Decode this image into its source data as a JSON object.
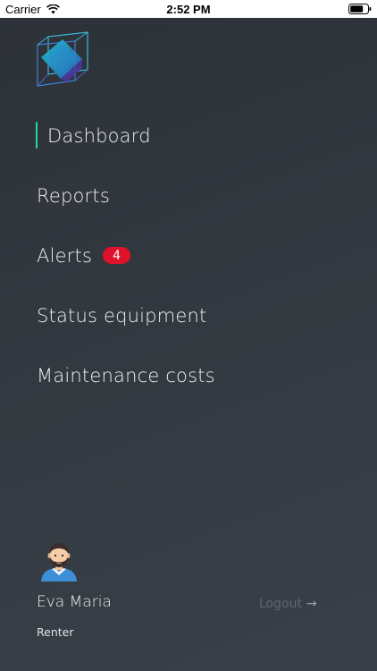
{
  "status_bar": {
    "carrier": "Carrier",
    "time": "2:52 PM",
    "wifi_icon": "wifi-icon",
    "battery_icon": "battery-icon"
  },
  "drawer": {
    "logo_icon": "cube-logo-icon",
    "colors": {
      "background": "#30363c",
      "active_indicator": "#23d6a0",
      "badge": "#e0112b",
      "logout_text": "#5e666f"
    },
    "menu": {
      "items": [
        {
          "label": "Dashboard",
          "active": true
        },
        {
          "label": "Reports"
        },
        {
          "label": "Alerts",
          "badge": "4"
        },
        {
          "label": "Status equipment"
        },
        {
          "label": "Maintenance costs"
        }
      ]
    },
    "user": {
      "avatar_icon": "bearded-man-avatar",
      "name": "Eva Maria",
      "role": "Renter"
    },
    "logout": {
      "label": "Logout",
      "arrow": "→"
    }
  }
}
